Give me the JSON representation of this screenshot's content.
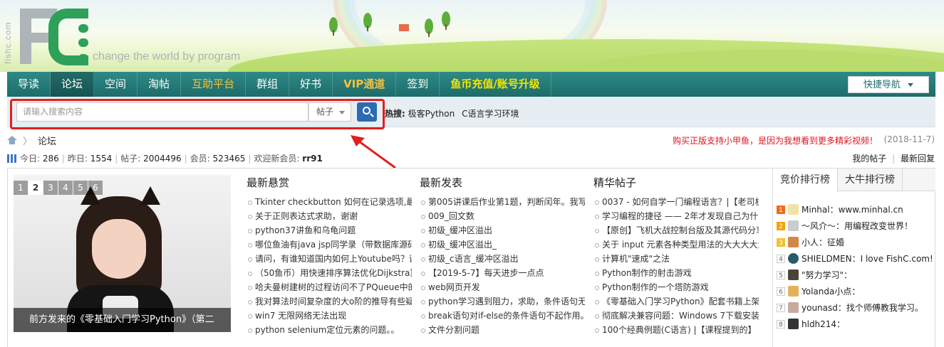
{
  "logo": {
    "side_text": "fishc.com",
    "slogan": "change the world by program"
  },
  "nav": {
    "items": [
      {
        "label": "导读"
      },
      {
        "label": "论坛"
      },
      {
        "label": "空间"
      },
      {
        "label": "淘帖"
      },
      {
        "label": "互助平台"
      },
      {
        "label": "群组"
      },
      {
        "label": "好书"
      },
      {
        "label": "VIP通道"
      },
      {
        "label": "签到"
      },
      {
        "label": "鱼币充值/账号升级"
      }
    ],
    "quick_nav": "快捷导航"
  },
  "search": {
    "placeholder": "请输入搜索内容",
    "type": "帖子",
    "hot_label": "热搜:",
    "hot_items": [
      "极客Python",
      "C语言学习环境"
    ]
  },
  "breadcrumb": {
    "current": "论坛"
  },
  "promo": {
    "text": "购买正版支持小甲鱼，是因为我想看到更多精彩视频！",
    "date": "(2018-11-7)"
  },
  "stats": {
    "today_label": "今日:",
    "today": "286",
    "yesterday_label": "昨日:",
    "yesterday": "1554",
    "posts_label": "帖子:",
    "posts": "2004496",
    "members_label": "会员:",
    "members": "523465",
    "welcome_label": "欢迎新会员:",
    "new_member": "rr91",
    "my_posts": "我的帖子",
    "latest_reply": "最新回复"
  },
  "slider": {
    "pages": [
      "1",
      "2",
      "3",
      "4",
      "5",
      "6"
    ],
    "caption": "前方发来的《零基础入门学习Python》（第二"
  },
  "columns": [
    {
      "title": "最新悬赏",
      "items": [
        "Tkinter checkbutton 如何在记录选项,最后",
        "关于正则表达式求助，谢谢",
        "python37讲鱼和乌龟问题",
        "哪位鱼油有java jsp同学录（带数据库源码）",
        "请问，有谁知道国内如何上Youtube吗？谢",
        "（50鱼币）用快速排序算法优化Dijkstra算",
        "哈夫曼树建树的过程访问不了PQueue中的",
        "我对算法时间复杂度的大o阶的推导有些疑",
        "win7 无限网络无法出现",
        "python selenium定位元素的问题。。"
      ]
    },
    {
      "title": "最新发表",
      "items": [
        "第005讲课后作业第1题，判断闰年。我写的",
        "009_回文数",
        "初级_缓冲区溢出",
        "初级_缓冲区溢出_",
        "初级_c语言_缓冲区溢出",
        "【2019-5-7】每天进步一点点",
        "web网页开发",
        "python学习遇到阻力，求助，条件语句无法",
        "break语句对if-else的条件语句不起作用。",
        "文件分割问题"
      ]
    },
    {
      "title": "精华帖子",
      "items": [
        "0037 - 如何自学一门编程语言？|【老司机",
        "学习编程的捷径 —— 2年才发现自己为什么",
        "【原创】飞机大战控制台版及其源代码分享",
        "关于 input 元素各种类型用法的大大大大大",
        "计算机\"速成\"之法",
        "Python制作的射击游戏",
        "Python制作的一个塔防游戏",
        "《零基础入门学习Python》配套书籍上架",
        "彻底解决兼容问题：Windows 7下载安装",
        "100个经典例题(C语言) |【课程提到的】"
      ]
    }
  ],
  "rank": {
    "tabs": [
      "竞价排行榜",
      "大牛排行榜"
    ],
    "items": [
      {
        "num": "1",
        "text": "Minhal：www.minhal.cn"
      },
      {
        "num": "2",
        "text": "～风介～：用编程改变世界！"
      },
      {
        "num": "3",
        "text": "小人：征婚"
      },
      {
        "num": "4",
        "text": "SHIELDMEN：I love FishC.com!"
      },
      {
        "num": "5",
        "text": "\"努力学习\"："
      },
      {
        "num": "6",
        "text": "Yolanda小点："
      },
      {
        "num": "7",
        "text": "younasd：找个师傅教我学习。"
      },
      {
        "num": "8",
        "text": "hldh214："
      }
    ]
  },
  "colors": {
    "nav_bg": "#1d6c6a",
    "promo": "#e0141e",
    "highlight_box": "#e01f1f",
    "search_btn": "#2c6bb3"
  }
}
